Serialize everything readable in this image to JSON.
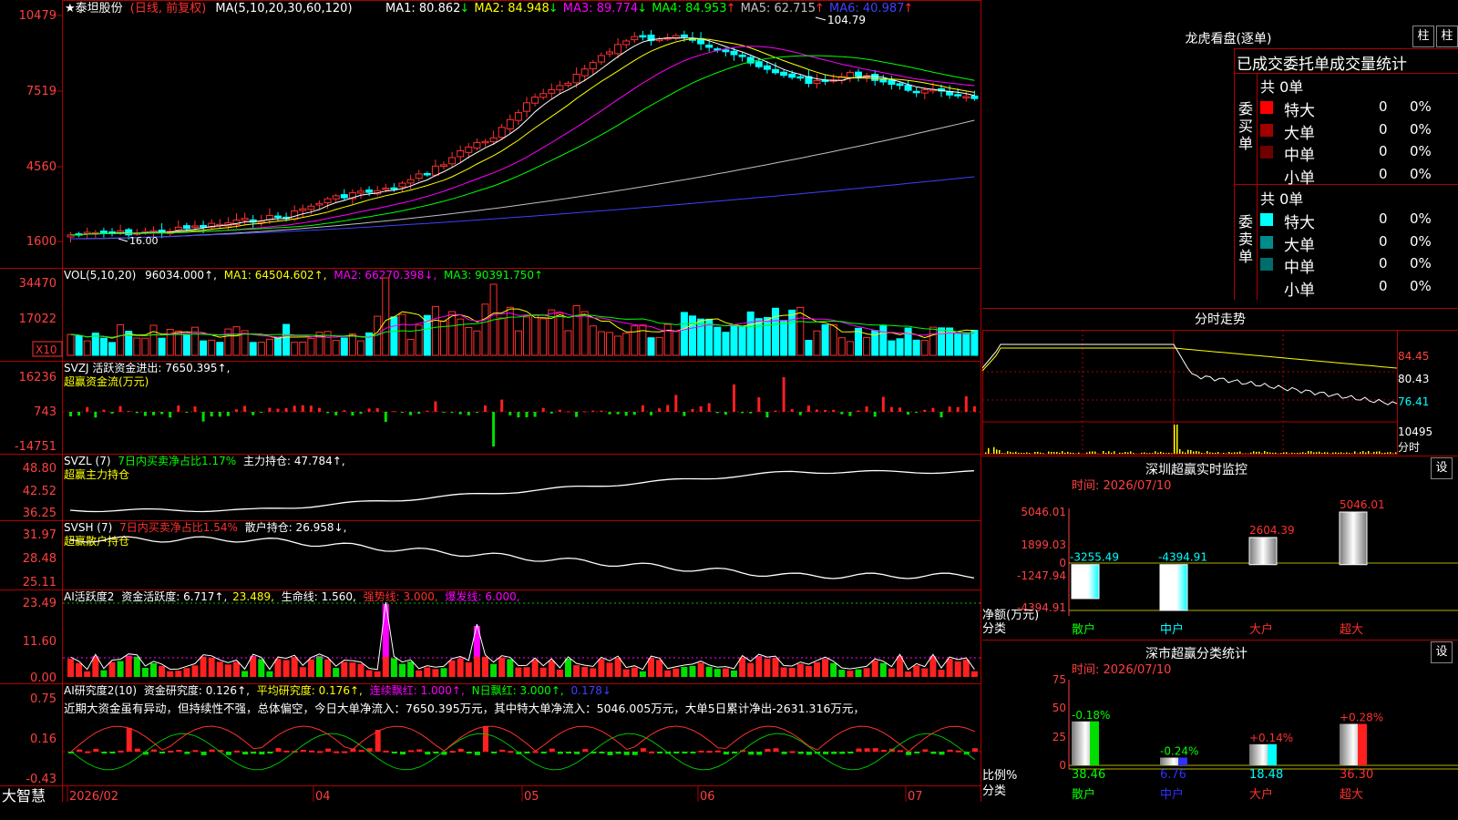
{
  "main": {
    "title": "★泰坦股份",
    "mode": "(日线, 前复权)",
    "ma_label": "MA(5,10,20,30,60,120)",
    "ma_values": [
      {
        "label": "MA1: 80.862",
        "arrow": "↓",
        "color": "#ffffff"
      },
      {
        "label": "MA2: 84.948",
        "arrow": "↓",
        "color": "#ffff00"
      },
      {
        "label": "MA3: 89.774",
        "arrow": "↓",
        "color": "#ff00ff"
      },
      {
        "label": "MA4: 84.953",
        "arrow": "↑",
        "color": "#00ff00"
      },
      {
        "label": "MA5: 62.715",
        "arrow": "↑",
        "color": "#c0c0c0"
      },
      {
        "label": "MA6: 40.987",
        "arrow": "↑",
        "color": "#4040ff"
      }
    ],
    "yticks": [
      "10479",
      "7519",
      "4560",
      "1600"
    ],
    "high_label": "104.79",
    "low_label": "16.00"
  },
  "vol": {
    "header": [
      "VOL(5,10,20)",
      "96034.000↑,",
      "MA1: 64504.602↑,",
      "MA2: 66270.398↓,",
      "MA3: 90391.750↑"
    ],
    "yticks": [
      "34470",
      "17022"
    ],
    "unit": "X10"
  },
  "svzj": {
    "header": "SVZJ  活跃资金进出: 7650.395↑,",
    "sub": "超赢资金流(万元)",
    "yticks": [
      "16236",
      "743",
      "-14751"
    ]
  },
  "svzl": {
    "header_a": "SVZL (7)",
    "header_b": "7日内买卖净占比1.17%",
    "header_c": "主力持仓: 47.784↑,",
    "sub": "超赢主力持仓",
    "yticks": [
      "48.80",
      "42.52",
      "36.25"
    ]
  },
  "svsh": {
    "header_a": "SVSH (7)",
    "header_b": "7日内买卖净占比1.54%",
    "header_c": "散户持仓: 26.958↓,",
    "sub": "超赢散户持仓",
    "yticks": [
      "31.97",
      "28.48",
      "25.11"
    ]
  },
  "ai_active": {
    "header": [
      "AI活跃度2",
      "资金活跃度: 6.717↑,",
      "23.489,",
      "生命线: 1.560,",
      "强势线: 3.000,",
      "爆发线: 6.000,"
    ],
    "yticks": [
      "23.49",
      "11.60",
      "0.00"
    ]
  },
  "ai_research": {
    "header": [
      "AI研究度2(10)",
      "资金研究度: 0.126↑,",
      "平均研究度: 0.176↑,",
      "连续飘红: 1.000↑,",
      "N日飘红: 3.000↑,",
      "0.178↓"
    ],
    "summary": "近期大资金虽有异动，但持续性不强，总体偏空，今日大单净流入：7650.395万元，其中特大单净流入：5046.005万元，大单5日累计净出-2631.316万元，",
    "yticks": [
      "0.75",
      "0.16",
      "-0.43"
    ]
  },
  "xaxis": {
    "brand": "大智慧",
    "labels": [
      "2026/02",
      "04",
      "05",
      "06",
      "07"
    ]
  },
  "right": {
    "lhb_title": "龙虎看盘(逐单)",
    "btn_zhu": "柱",
    "btn_zhe": "柱",
    "stat_title": "已成交委托单成交量统计",
    "buy_label": "委买单",
    "sell_label": "委卖单",
    "buy_total": "共 0单",
    "sell_total": "共 0单",
    "buy_rows": [
      {
        "name": "特大",
        "val": "0",
        "pct": "0%",
        "color": "#ff0000"
      },
      {
        "name": "大单",
        "val": "0",
        "pct": "0%",
        "color": "#a00000"
      },
      {
        "name": "中单",
        "val": "0",
        "pct": "0%",
        "color": "#700000"
      },
      {
        "name": "小单",
        "val": "0",
        "pct": "0%",
        "color": ""
      }
    ],
    "sell_rows": [
      {
        "name": "特大",
        "val": "0",
        "pct": "0%",
        "color": "#00ffff"
      },
      {
        "name": "大单",
        "val": "0",
        "pct": "0%",
        "color": "#008c8c"
      },
      {
        "name": "中单",
        "val": "0",
        "pct": "0%",
        "color": "#006c6c"
      },
      {
        "name": "小单",
        "val": "0",
        "pct": "0%",
        "color": ""
      }
    ],
    "intraday_title": "分时走势",
    "intraday_y": [
      "84.45",
      "80.43",
      "76.41",
      "10495"
    ],
    "intraday_unit": "分时",
    "monitor_title": "深圳超赢实时监控",
    "monitor_btn": "设",
    "monitor_time": "时间: 2026/07/10",
    "monitor_y": [
      "5046.01",
      "1899.03",
      "0",
      "-1247.94",
      "-4394.91"
    ],
    "monitor_ylabel": "净额(万元)",
    "monitor_xlabel": "分类",
    "class_title": "深市超赢分类统计",
    "class_btn": "设",
    "class_time": "时间: 2026/07/10",
    "class_y": [
      "75",
      "50",
      "25",
      "0"
    ],
    "class_ylabel": "比例%",
    "class_xlabel": "分类"
  },
  "chart_data": [
    {
      "type": "bar",
      "title": "深圳超赢实时监控",
      "ylabel": "净额(万元)",
      "xlabel": "分类",
      "categories": [
        "散户",
        "中户",
        "大户",
        "超大"
      ],
      "values": [
        -3255.49,
        -4394.91,
        2604.39,
        5046.01
      ],
      "ylim": [
        -4394.91,
        5046.01
      ]
    },
    {
      "type": "bar",
      "title": "深市超赢分类统计",
      "ylabel": "比例%",
      "xlabel": "分类",
      "categories": [
        "散户",
        "中户",
        "大户",
        "超大"
      ],
      "values": [
        38.46,
        6.76,
        18.48,
        36.3
      ],
      "changes": [
        "-0.18%",
        "-0.24%",
        "+0.14%",
        "+0.28%"
      ],
      "ylim": [
        0,
        75
      ]
    }
  ]
}
